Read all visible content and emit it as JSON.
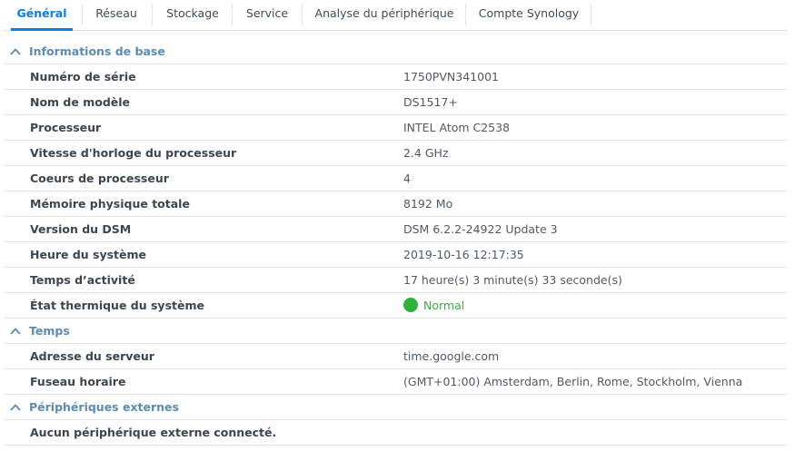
{
  "tabs": [
    {
      "label": "Général",
      "active": true
    },
    {
      "label": "Réseau",
      "active": false
    },
    {
      "label": "Stockage",
      "active": false
    },
    {
      "label": "Service",
      "active": false
    },
    {
      "label": "Analyse du périphérique",
      "active": false
    },
    {
      "label": "Compte Synology",
      "active": false
    }
  ],
  "sections": {
    "basic": {
      "title": "Informations de base",
      "rows": [
        {
          "label": "Numéro de série",
          "value": "1750PVN341001"
        },
        {
          "label": "Nom de modèle",
          "value": "DS1517+"
        },
        {
          "label": "Processeur",
          "value": "INTEL Atom C2538"
        },
        {
          "label": "Vitesse d'horloge du processeur",
          "value": "2.4 GHz"
        },
        {
          "label": "Coeurs de processeur",
          "value": "4"
        },
        {
          "label": "Mémoire physique totale",
          "value": "8192 Mo"
        },
        {
          "label": "Version du DSM",
          "value": "DSM 6.2.2-24922 Update 3"
        },
        {
          "label": "Heure du système",
          "value": "2019-10-16 12:17:35"
        },
        {
          "label": "Temps d’activité",
          "value": "17 heure(s) 3 minute(s) 33 seconde(s)"
        }
      ],
      "thermal": {
        "label": "État thermique du système",
        "status": "Normal",
        "status_color": "#2fb23c"
      }
    },
    "time": {
      "title": "Temps",
      "rows": [
        {
          "label": "Adresse du serveur",
          "value": "time.google.com"
        },
        {
          "label": "Fuseau horaire",
          "value": "(GMT+01:00) Amsterdam, Berlin, Rome, Stockholm, Vienna"
        }
      ]
    },
    "external": {
      "title": "Périphériques externes",
      "message": "Aucun périphérique externe connecté."
    }
  },
  "colors": {
    "accent": "#057feb",
    "section_title": "#5c8bb4",
    "status_ok": "#2fb23c"
  },
  "icons": {
    "section_toggle": "chevron-up-icon",
    "thermal_status": "green-circle-status-icon"
  }
}
